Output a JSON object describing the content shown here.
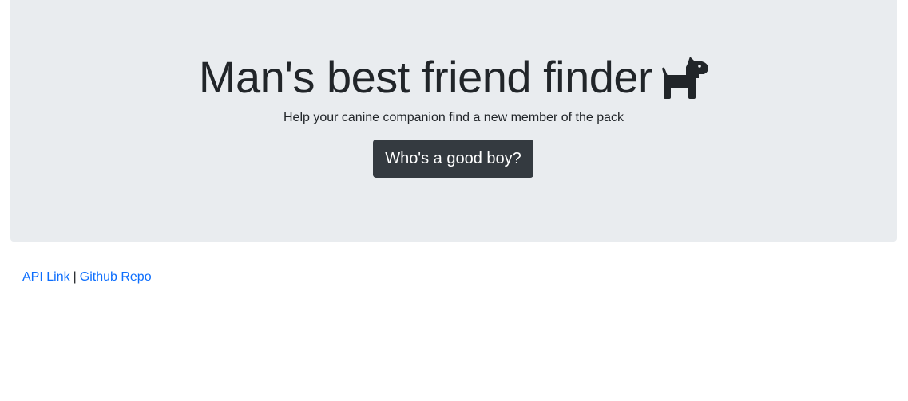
{
  "hero": {
    "title": "Man's best friend finder",
    "subtitle": "Help your canine companion find a new member of the pack",
    "button_label": "Who's a good boy?",
    "title_icon": "dog-icon"
  },
  "footer": {
    "api_link_label": "API Link",
    "separator": "|",
    "github_link_label": "Github Repo"
  },
  "colors": {
    "jumbotron_bg": "#e9ecef",
    "button_bg": "#343a40",
    "link": "#0d6efd",
    "text": "#212529"
  }
}
